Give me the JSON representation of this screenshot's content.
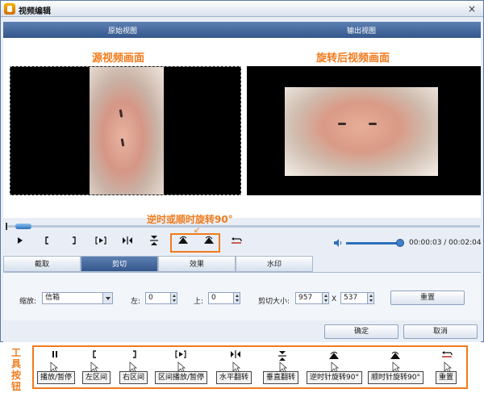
{
  "window": {
    "title": "视频编辑",
    "close_glyph": "×"
  },
  "view_headers": {
    "original": "原始视图",
    "output": "输出视图"
  },
  "captions": {
    "source": "源视频画面",
    "rotated": "旋转后视频画面",
    "rotate_hint": "逆时或顺时旋转90°"
  },
  "playback": {
    "timecode": "00:00:03 / 00:02:04",
    "volume_level": 0.95
  },
  "tabs": [
    "截取",
    "剪切",
    "效果",
    "水印"
  ],
  "active_tab": "剪切",
  "crop": {
    "zoom_label": "缩放:",
    "zoom_value": "信箱",
    "left_label": "左:",
    "left_value": "0",
    "top_label": "上:",
    "top_value": "0",
    "size_label": "剪切大小:",
    "width_value": "957",
    "x_label": "X",
    "height_value": "537",
    "reset_label": "重置"
  },
  "footer": {
    "ok_label": "确定",
    "cancel_label": "取消"
  },
  "legend": {
    "side_title": "工具按钮",
    "items": [
      {
        "icon": "pause-icon",
        "label": "播放/暂停"
      },
      {
        "icon": "left-bracket-icon",
        "label": "左区间"
      },
      {
        "icon": "right-bracket-icon",
        "label": "右区间"
      },
      {
        "icon": "play-range-icon",
        "label": "区间播放/暂停"
      },
      {
        "icon": "flip-horizontal-icon",
        "label": "水平翻转"
      },
      {
        "icon": "flip-vertical-icon",
        "label": "垂直翻转"
      },
      {
        "icon": "rotate-ccw-icon",
        "label": "逆时针旋转90°"
      },
      {
        "icon": "rotate-cw-icon",
        "label": "顺时针旋转90°"
      },
      {
        "icon": "reset-icon",
        "label": "重置"
      }
    ]
  }
}
